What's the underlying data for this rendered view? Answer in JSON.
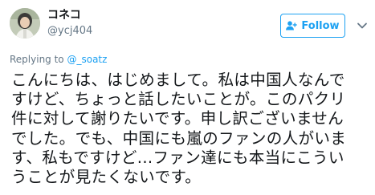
{
  "user": {
    "display_name": "コネコ",
    "handle": "@ycj404"
  },
  "follow_button": {
    "label": "Follow",
    "icon": "add-user-icon"
  },
  "menu": {
    "icon": "chevron-down-icon"
  },
  "reply": {
    "prefix": "Replying to ",
    "handle": "@_soatz"
  },
  "tweet": {
    "lines": [
      "こんにちは、はじめまして。私は中国人なんで",
      "すけど、ちょっと話したいことが。このパクリ",
      "件に対して謝りたいです。申し訳ございません",
      "でした。でも、中国にも嵐のファンの人がいま",
      "す、私もですけど...ファン達にも本当にこうい",
      "うことが見たくないです。"
    ]
  },
  "colors": {
    "accent": "#1da1f2",
    "text": "#14171a",
    "muted": "#657786"
  }
}
